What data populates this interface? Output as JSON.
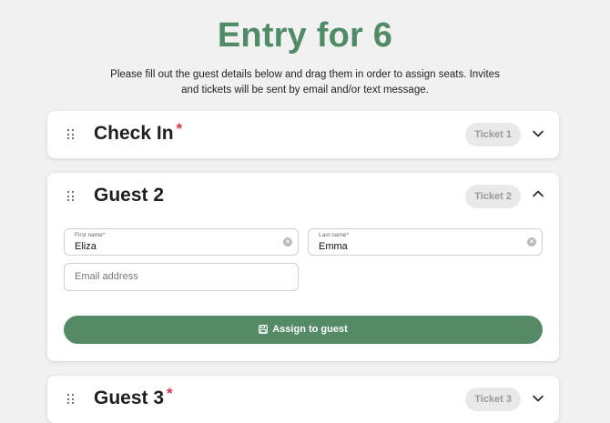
{
  "page": {
    "title": "Entry for 6",
    "subtitle": "Please fill out the guest details below and drag them in order to assign seats. Invites and tickets will be sent by email and/or text message."
  },
  "cards": [
    {
      "title": "Check In",
      "required": "*",
      "ticket": "Ticket 1",
      "expanded": false
    },
    {
      "title": "Guest 2",
      "required": "",
      "ticket": "Ticket 2",
      "expanded": true,
      "first_name": {
        "label": "First name",
        "required": "*",
        "value": "Eliza"
      },
      "last_name": {
        "label": "Last name",
        "required": "*",
        "value": "Emma"
      },
      "email": {
        "placeholder": "Email address",
        "value": ""
      },
      "assign_label": "Assign to guest"
    },
    {
      "title": "Guest 3",
      "required": "*",
      "ticket": "Ticket 3",
      "expanded": false
    }
  ],
  "icons": {
    "drag": "drag-handle-icon",
    "chevron_down": "chevron-down-icon",
    "chevron_up": "chevron-up-icon",
    "clear": "clear-icon",
    "assign": "save-icon"
  },
  "colors": {
    "accent": "#548a65",
    "title": "#4f8b66",
    "required": "#e0334a",
    "badge_bg": "#e9e9e9",
    "badge_text": "#9a9a9a"
  }
}
